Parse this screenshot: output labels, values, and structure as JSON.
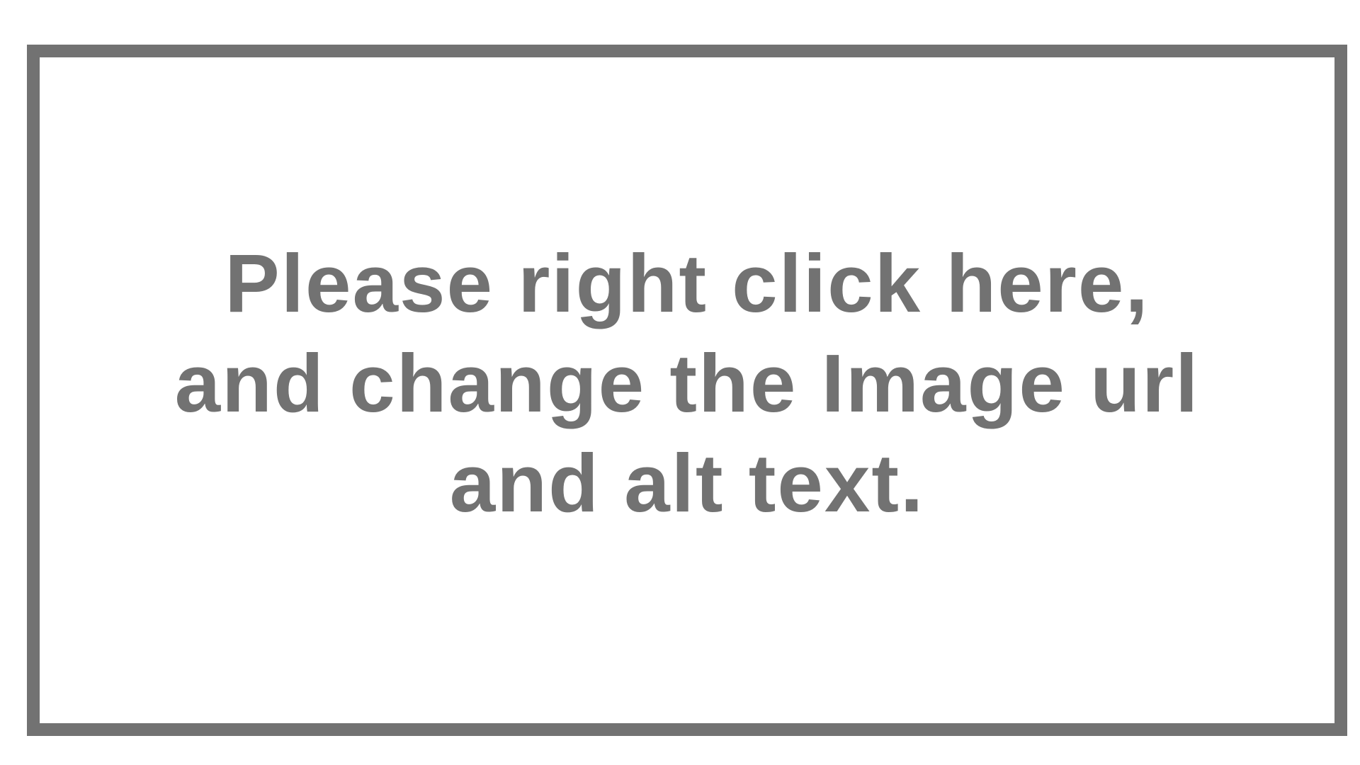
{
  "placeholder": {
    "lines": [
      "Please right click here,",
      "and change the Image url",
      "and alt text."
    ]
  },
  "colors": {
    "border": "#727272",
    "text": "#727272",
    "background": "#ffffff"
  }
}
